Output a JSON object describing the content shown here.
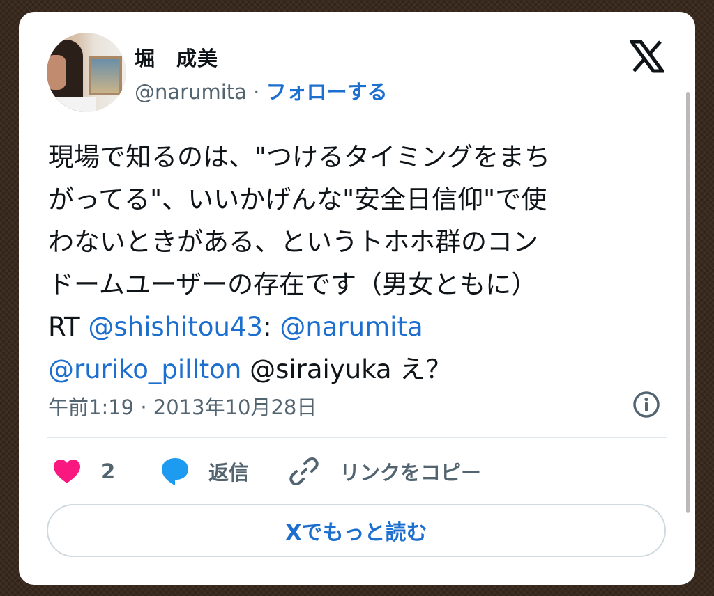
{
  "author": {
    "display_name": "堀　成美",
    "handle": "@narumita",
    "separator": " · ",
    "follow_label": "フォローする"
  },
  "tweet": {
    "lines": [
      "現場で知るのは、\"つけるタイミングをまち",
      "がってる\"、いいかげんな\"安全日信仰\"で使",
      "わないときがある、というトホホ群のコン",
      "ドームユーザーの存在です（男女ともに）"
    ],
    "rt_prefix": "RT ",
    "mention_1": "@shishitou43",
    "colon": ": ",
    "mention_2": "@narumita",
    "mention_3": "@ruriko_pillton",
    "tail": " @siraiyuka え？"
  },
  "timestamp": "午前1:19 · 2013年10月28日",
  "actions": {
    "like_count": "2",
    "reply_label": "返信",
    "copy_link_label": "リンクをコピー"
  },
  "read_more_label": "Xでもっと読む",
  "colors": {
    "link": "#1d6fcf",
    "like": "#f91880",
    "reply_icon": "#1d9bf0",
    "muted": "#536471",
    "text": "#0f1419"
  },
  "icons": [
    "x-logo-icon",
    "info-icon",
    "heart-icon",
    "reply-bubble-icon",
    "link-icon"
  ]
}
